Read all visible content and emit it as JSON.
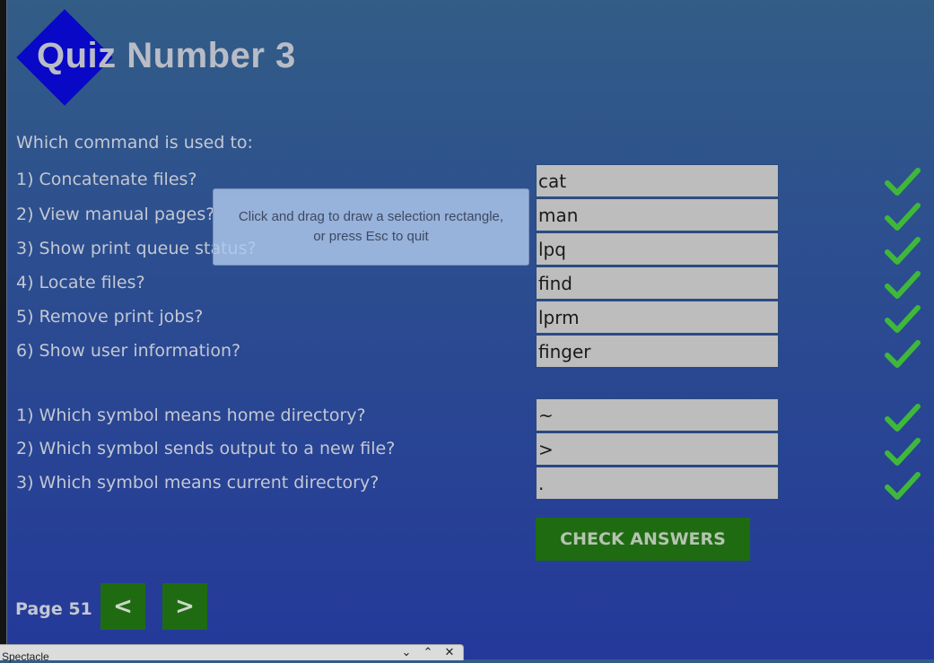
{
  "header": {
    "title": "Quiz Number 3"
  },
  "intro": "Which command is used to:",
  "commands": [
    {
      "label": "1) Concatenate files?",
      "answer": "cat"
    },
    {
      "label": "2) View manual pages?",
      "answer": "man"
    },
    {
      "label": "3) Show print queue status?",
      "answer": "lpq"
    },
    {
      "label": "4) Locate files?",
      "answer": "find"
    },
    {
      "label": "5) Remove print jobs?",
      "answer": "lprm"
    },
    {
      "label": "6) Show user information?",
      "answer": "finger"
    }
  ],
  "symbols": [
    {
      "label": "1) Which symbol means home directory?",
      "answer": "~"
    },
    {
      "label": "2) Which symbol sends output to a new file?",
      "answer": ">"
    },
    {
      "label": "3) Which symbol means current directory?",
      "answer": "."
    }
  ],
  "check_button": "CHECK ANSWERS",
  "pager": {
    "page_label": "Page 51",
    "prev": "<",
    "next": ">"
  },
  "overlay": {
    "line1": "Click and drag to draw a selection rectangle,",
    "line2": "or press Esc to quit"
  },
  "taskbar": {
    "title": "Spectacle"
  },
  "icons": {
    "correct": "checkmark-icon",
    "close": "close-icon",
    "maximize": "chevron-up-icon",
    "minimize": "chevron-down-icon"
  },
  "colors": {
    "check_green": "#3fb83a",
    "button_green": "#1f6b12",
    "logo_blue": "#0808c6"
  }
}
